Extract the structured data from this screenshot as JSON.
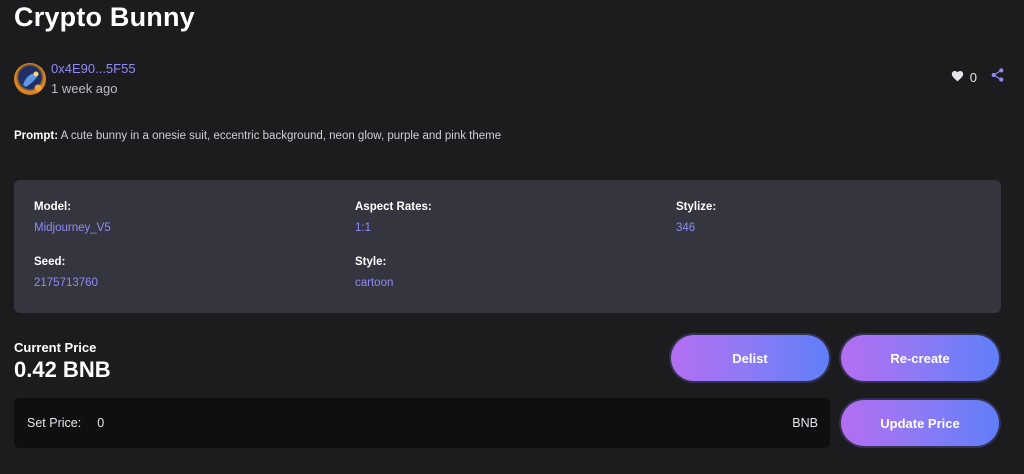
{
  "title": "Crypto Bunny",
  "author": {
    "address": "0x4E90...5F55",
    "time": "1 week ago",
    "avatar_icon": "avatar-icon"
  },
  "actions": {
    "like_icon": "heart-icon",
    "like_count": "0",
    "share_icon": "share-icon"
  },
  "prompt": {
    "label": "Prompt:",
    "text": " A cute bunny in a onesie suit, eccentric background, neon glow, purple and pink theme"
  },
  "details": {
    "model": {
      "label": "Model:",
      "value": "Midjourney_V5"
    },
    "aspect": {
      "label": "Aspect Rates:",
      "value": "1:1"
    },
    "stylize": {
      "label": "Stylize:",
      "value": "346"
    },
    "seed": {
      "label": "Seed:",
      "value": "2175713760"
    },
    "style": {
      "label": "Style:",
      "value": "cartoon"
    }
  },
  "price": {
    "label": "Current Price",
    "value": "0.42 BNB"
  },
  "buttons": {
    "delist": "Delist",
    "recreate": "Re-create",
    "update": "Update Price"
  },
  "set_price": {
    "label": "Set Price:",
    "value": "0",
    "currency": "BNB"
  },
  "colors": {
    "background": "#1c1c1f",
    "panel": "#34353e",
    "accent": "#8f8cf7",
    "button_start": "#b46ef2",
    "button_end": "#5f7ff8"
  }
}
